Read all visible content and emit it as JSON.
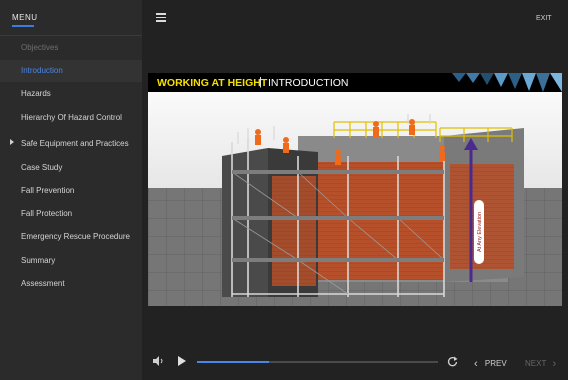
{
  "menu": {
    "title": "MENU",
    "items": [
      {
        "label": "Objectives",
        "state": "visited"
      },
      {
        "label": "Introduction",
        "state": "active"
      },
      {
        "label": "Hazards",
        "state": "normal"
      },
      {
        "label": "Hierarchy Of Hazard Control",
        "state": "normal"
      },
      {
        "label": "Safe Equipment and Practices",
        "state": "expandable"
      },
      {
        "label": "Case Study",
        "state": "normal"
      },
      {
        "label": "Fall Prevention",
        "state": "normal"
      },
      {
        "label": "Fall Protection",
        "state": "normal"
      },
      {
        "label": "Emergency Rescue Procedure",
        "state": "normal"
      },
      {
        "label": "Summary",
        "state": "normal"
      },
      {
        "label": "Assessment",
        "state": "normal"
      }
    ]
  },
  "header": {
    "exit_label": "EXIT",
    "menu_icon": "hamburger-icon"
  },
  "slide": {
    "title_main": "WORKING AT HEIGHT",
    "divider": "|",
    "title_sub": "INTRODUCTION",
    "elevation_label": "At Any Elevation"
  },
  "controls": {
    "progress": 0.3,
    "prev_label": "PREV",
    "next_label": "NEXT",
    "icons": [
      "volume-icon",
      "play-icon",
      "replay-icon",
      "chevron-left-icon",
      "chevron-right-icon"
    ]
  },
  "colors": {
    "accent": "#4a86e8",
    "title_yellow": "#f4e000",
    "elevation_arrow": "#4b2a8c"
  }
}
